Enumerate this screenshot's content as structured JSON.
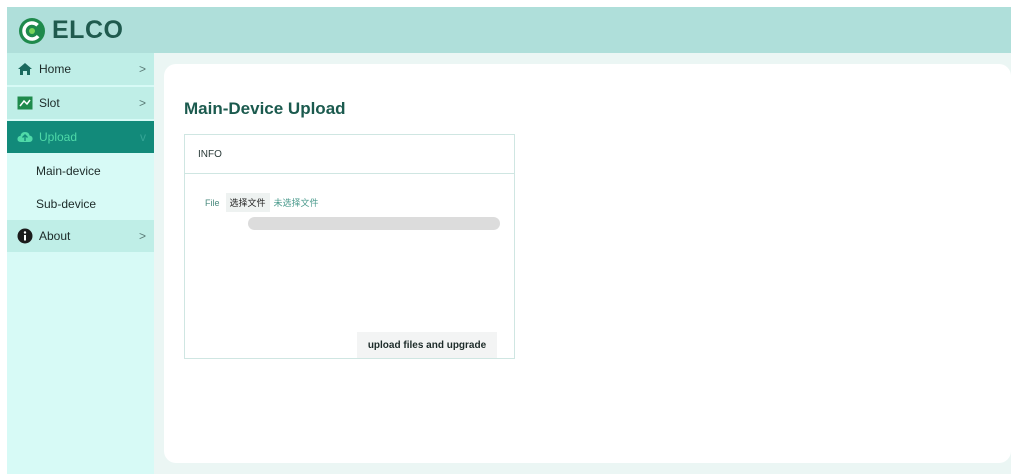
{
  "header": {
    "logo_text": "ELCO"
  },
  "sidebar": {
    "items": [
      {
        "label": "Home",
        "icon": "home-icon",
        "chevron": ">"
      },
      {
        "label": "Slot",
        "icon": "slot-icon",
        "chevron": ">"
      },
      {
        "label": "Upload",
        "icon": "upload-icon",
        "chevron": "v"
      },
      {
        "label": "About",
        "icon": "info-icon",
        "chevron": ">"
      }
    ],
    "sub_items": [
      {
        "label": "Main-device"
      },
      {
        "label": "Sub-device"
      }
    ]
  },
  "main": {
    "title": "Main-Device Upload",
    "card": {
      "header": "INFO",
      "file_label": "File",
      "file_button": "选择文件",
      "file_status": "未选择文件",
      "progress": 0,
      "upload_button": "upload files and upgrade"
    }
  },
  "colors": {
    "header_bg": "#afdfda",
    "sidebar_bg": "#d7faf6",
    "active_item_bg": "#128a7a",
    "accent_text": "#1b5a4e"
  }
}
